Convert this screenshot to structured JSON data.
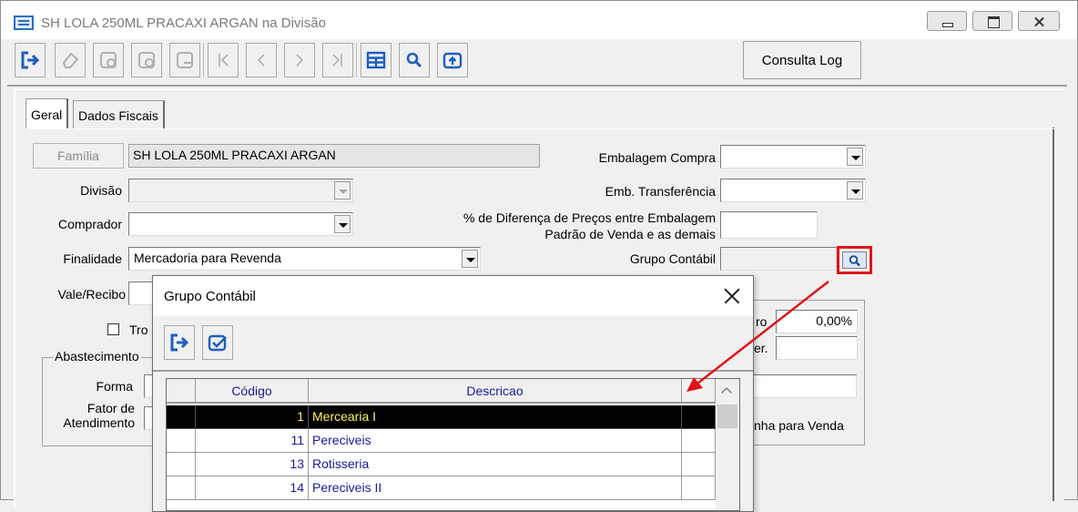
{
  "window": {
    "title": "SH LOLA 250ML PRACAXI ARGAN na Divisão"
  },
  "toolbar": {
    "buttons": [
      "exit-icon",
      "eraser-icon",
      "new-record-icon",
      "save-record-icon",
      "delete-record-icon",
      "first-icon",
      "prev-icon",
      "next-icon",
      "last-icon",
      "grid-icon",
      "search-icon",
      "export-icon"
    ],
    "consulta_log": "Consulta Log"
  },
  "tabs": [
    {
      "label": "Geral",
      "active": true
    },
    {
      "label": "Dados Fiscais",
      "active": false
    }
  ],
  "form": {
    "familia_label": "Família",
    "familia_value": "SH LOLA 250ML PRACAXI ARGAN",
    "divisao_label": "Divisão",
    "divisao_value": "",
    "comprador_label": "Comprador",
    "comprador_value": "",
    "finalidade_label": "Finalidade",
    "finalidade_value": "Mercadoria para Revenda",
    "vale_label": "Vale/Recibo",
    "tro_label": "Tro",
    "abastecimento_label": "Abastecimento",
    "forma_label": "Forma",
    "fator_label_1": "Fator de",
    "fator_label_2": "Atendimento",
    "emb_compra_label": "Embalagem Compra",
    "emb_compra_value": "",
    "emb_transf_label": "Emb. Transferência",
    "emb_transf_value": "",
    "dif_label_1": "% de Diferença de Preços entre Embalagem",
    "dif_label_2": "Padrão de Venda e as demais",
    "dif_value": "",
    "grupo_label": "Grupo Contábil",
    "grupo_value": "",
    "right_frag_1": "ro",
    "right_value_1": "0,00%",
    "right_frag_2": "er.",
    "right_frag_3": "nha para Venda"
  },
  "dialog": {
    "title": "Grupo Contábil",
    "toolbar": [
      "exit-icon",
      "confirm-icon"
    ],
    "columns": [
      "Código",
      "Descricao"
    ],
    "rows": [
      {
        "codigo": "1",
        "descricao": "Mercearia I",
        "selected": true
      },
      {
        "codigo": "11",
        "descricao": "Pereciveis",
        "selected": false
      },
      {
        "codigo": "13",
        "descricao": "Rotisseria",
        "selected": false
      },
      {
        "codigo": "14",
        "descricao": "Pereciveis II",
        "selected": false
      }
    ]
  },
  "colors": {
    "highlight_red": "#e0141a",
    "selected_row_bg": "#000000",
    "selected_row_text": "#fff45a",
    "grid_text": "#1a1a9a",
    "icon_blue": "#1f5fbf"
  }
}
